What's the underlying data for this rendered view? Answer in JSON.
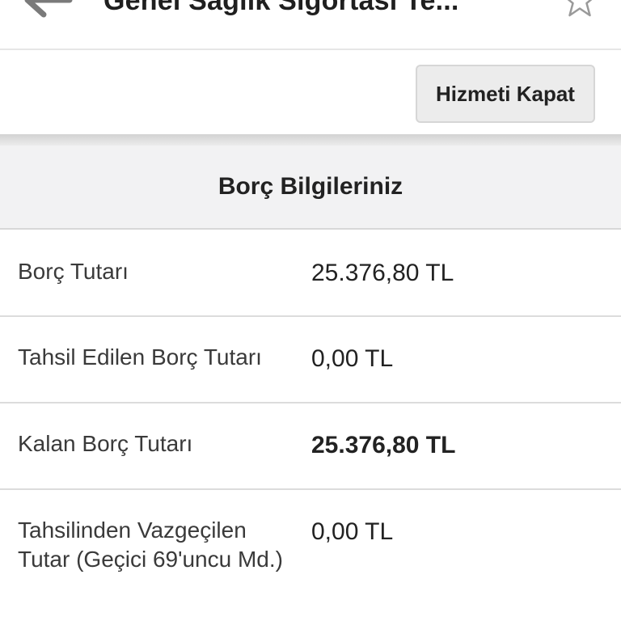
{
  "header": {
    "title": "Genel Sağlık Sigortası Te...",
    "back_icon": "arrow-left-icon",
    "favorite_icon": "star-outline-icon"
  },
  "toolbar": {
    "close_service_label": "Hizmeti Kapat"
  },
  "debt_section": {
    "title": "Borç Bilgileriniz",
    "rows": [
      {
        "label": "Borç Tutarı",
        "value": "25.376,80 TL",
        "emphasis": false
      },
      {
        "label": "Tahsil Edilen Borç Tutarı",
        "value": "0,00 TL",
        "emphasis": false
      },
      {
        "label": "Kalan Borç Tutarı",
        "value": "25.376,80 TL",
        "emphasis": true
      },
      {
        "label": "Tahsilinden Vazgeçilen Tutar (Geçici 69'uncu Md.)",
        "value": "0,00 TL",
        "emphasis": false
      }
    ]
  },
  "colors": {
    "section_background": "#f2f2f3",
    "button_background": "#ececec",
    "divider": "#dcdcdc"
  }
}
